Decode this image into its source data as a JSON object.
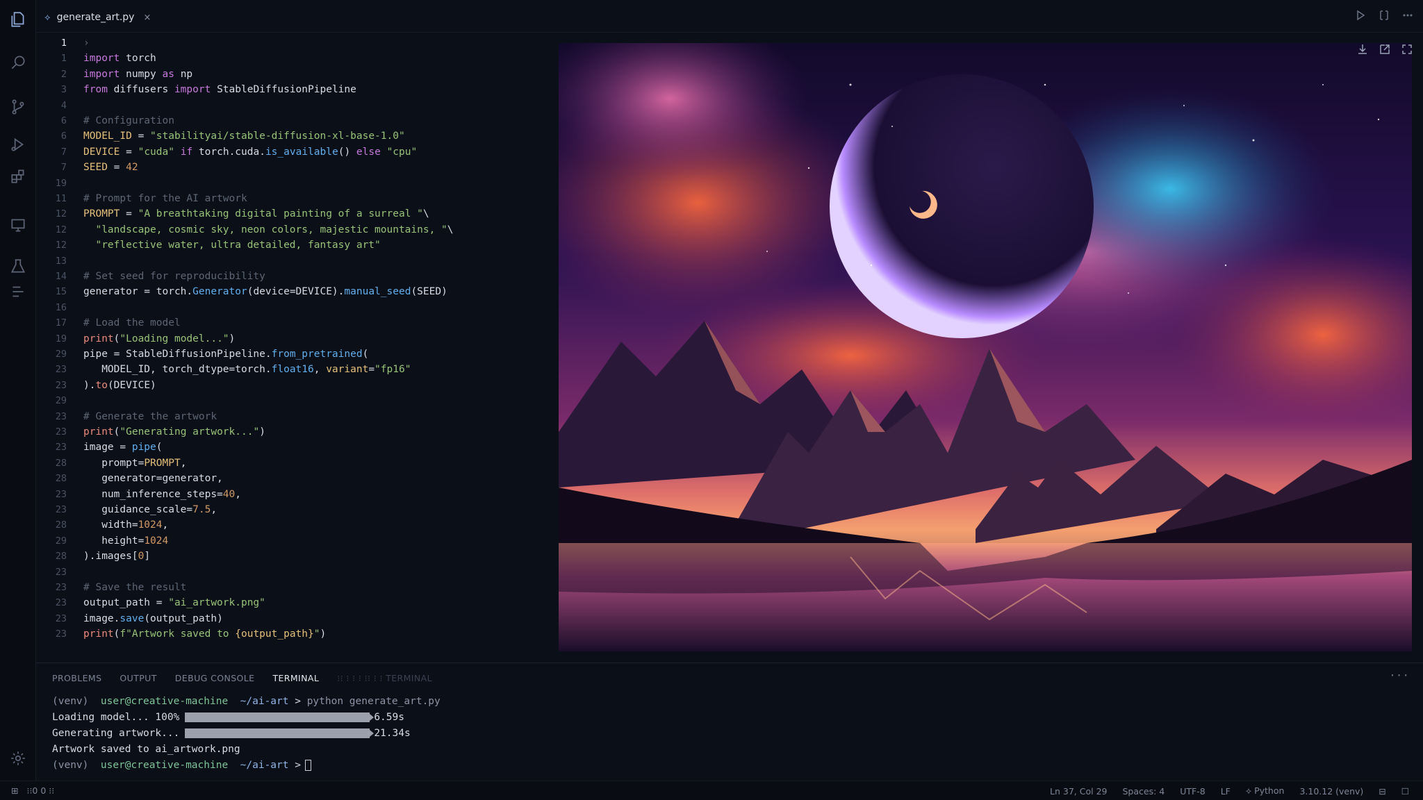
{
  "tab": {
    "filename": "generate_art.py",
    "close_glyph": "×"
  },
  "editor": {
    "lines": [
      {
        "n": "1",
        "current": true,
        "parts": [
          [
            "cm",
            "›"
          ]
        ]
      },
      {
        "n": "1",
        "parts": [
          [
            "kw",
            "import"
          ],
          [
            "id",
            " torch"
          ]
        ]
      },
      {
        "n": "2",
        "parts": [
          [
            "kw",
            "import"
          ],
          [
            "id",
            " numpy "
          ],
          [
            "kw",
            "as"
          ],
          [
            "id",
            " np"
          ]
        ]
      },
      {
        "n": "3",
        "parts": [
          [
            "kw",
            "from"
          ],
          [
            "id",
            " diffusers "
          ],
          [
            "kw",
            "import"
          ],
          [
            "id",
            " StableDiffusionPipeline"
          ]
        ]
      },
      {
        "n": "4",
        "parts": []
      },
      {
        "n": "6",
        "parts": [
          [
            "cm",
            "# Configuration"
          ]
        ]
      },
      {
        "n": "6",
        "parts": [
          [
            "attr",
            "MODEL_ID"
          ],
          [
            "id",
            " = "
          ],
          [
            "str",
            "\"stabilityai/stable-diffusion-xl-base-1.0\""
          ]
        ]
      },
      {
        "n": "7",
        "parts": [
          [
            "attr",
            "DEVICE"
          ],
          [
            "id",
            " = "
          ],
          [
            "str",
            "\"cuda\""
          ],
          [
            "id",
            " "
          ],
          [
            "kw",
            "if"
          ],
          [
            "id",
            " torch.cuda."
          ],
          [
            "fn",
            "is_available"
          ],
          [
            "id",
            "() "
          ],
          [
            "kw",
            "else"
          ],
          [
            "id",
            " "
          ],
          [
            "str",
            "\"cpu\""
          ]
        ]
      },
      {
        "n": "7",
        "parts": [
          [
            "attr",
            "SEED"
          ],
          [
            "id",
            " = "
          ],
          [
            "num",
            "42"
          ]
        ]
      },
      {
        "n": "19",
        "parts": []
      },
      {
        "n": "11",
        "parts": [
          [
            "cm",
            "# Prompt for the AI artwork"
          ]
        ]
      },
      {
        "n": "12",
        "parts": [
          [
            "attr",
            "PROMPT"
          ],
          [
            "id",
            " = "
          ],
          [
            "str",
            "\"A breathtaking digital painting of a surreal \""
          ],
          [
            "id",
            "\\"
          ]
        ]
      },
      {
        "n": "12",
        "parts": [
          [
            "str",
            "  \"landscape, cosmic sky, neon colors, majestic mountains, \""
          ],
          [
            "id",
            "\\"
          ]
        ]
      },
      {
        "n": "12",
        "parts": [
          [
            "str",
            "  \"reflective water, ultra detailed, fantasy art\""
          ]
        ]
      },
      {
        "n": "13",
        "parts": []
      },
      {
        "n": "14",
        "parts": [
          [
            "cm",
            "# Set seed for reproducibility"
          ]
        ]
      },
      {
        "n": "15",
        "parts": [
          [
            "id",
            "generator = torch."
          ],
          [
            "fn",
            "Generator"
          ],
          [
            "id",
            "(device=DEVICE)."
          ],
          [
            "fn",
            "manual_seed"
          ],
          [
            "id",
            "(SEED)"
          ]
        ]
      },
      {
        "n": "16",
        "parts": []
      },
      {
        "n": "17",
        "parts": [
          [
            "cm",
            "# Load the model"
          ]
        ]
      },
      {
        "n": "19",
        "parts": [
          [
            "red",
            "print"
          ],
          [
            "id",
            "("
          ],
          [
            "str",
            "\"Loading model...\""
          ],
          [
            "id",
            ")"
          ]
        ]
      },
      {
        "n": "29",
        "parts": [
          [
            "id",
            "pipe = StableDiffusionPipeline."
          ],
          [
            "fn",
            "from_pretrained"
          ],
          [
            "id",
            "("
          ]
        ]
      },
      {
        "n": "23",
        "parts": [
          [
            "id",
            "   MODEL_ID, torch_dtype=torch."
          ],
          [
            "fn",
            "float16"
          ],
          [
            "id",
            ", "
          ],
          [
            "attr",
            "variant"
          ],
          [
            "id",
            "="
          ],
          [
            "str",
            "\"fp16\""
          ]
        ]
      },
      {
        "n": "23",
        "parts": [
          [
            "id",
            ")."
          ],
          [
            "red",
            "to"
          ],
          [
            "id",
            "(DEVICE)"
          ]
        ]
      },
      {
        "n": "29",
        "parts": []
      },
      {
        "n": "23",
        "parts": [
          [
            "cm",
            "# Generate the artwork"
          ]
        ]
      },
      {
        "n": "23",
        "parts": [
          [
            "red",
            "print"
          ],
          [
            "id",
            "("
          ],
          [
            "str",
            "\"Generating artwork...\""
          ],
          [
            "id",
            ")"
          ]
        ]
      },
      {
        "n": "23",
        "parts": [
          [
            "id",
            "image = "
          ],
          [
            "fn",
            "pipe"
          ],
          [
            "id",
            "("
          ]
        ]
      },
      {
        "n": "28",
        "parts": [
          [
            "id",
            "   prompt="
          ],
          [
            "attr",
            "PROMPT"
          ],
          [
            "id",
            ","
          ]
        ]
      },
      {
        "n": "28",
        "parts": [
          [
            "id",
            "   generator=generator,"
          ]
        ]
      },
      {
        "n": "23",
        "parts": [
          [
            "id",
            "   num_inference_steps="
          ],
          [
            "num",
            "40"
          ],
          [
            "id",
            ","
          ]
        ]
      },
      {
        "n": "23",
        "parts": [
          [
            "id",
            "   guidance_scale="
          ],
          [
            "num",
            "7.5"
          ],
          [
            "id",
            ","
          ]
        ]
      },
      {
        "n": "28",
        "parts": [
          [
            "id",
            "   width="
          ],
          [
            "num",
            "1024"
          ],
          [
            "id",
            ","
          ]
        ]
      },
      {
        "n": "29",
        "parts": [
          [
            "id",
            "   height="
          ],
          [
            "num",
            "1024"
          ]
        ]
      },
      {
        "n": "28",
        "parts": [
          [
            "id",
            ").images["
          ],
          [
            "num",
            "0"
          ],
          [
            "id",
            "]"
          ]
        ]
      },
      {
        "n": "23",
        "parts": []
      },
      {
        "n": "23",
        "parts": [
          [
            "cm",
            "# Save the result"
          ]
        ]
      },
      {
        "n": "23",
        "parts": [
          [
            "id",
            "output_path = "
          ],
          [
            "str",
            "\"ai_artwork.png\""
          ]
        ]
      },
      {
        "n": "23",
        "parts": [
          [
            "id",
            "image."
          ],
          [
            "fn",
            "save"
          ],
          [
            "id",
            "(output_path)"
          ]
        ]
      },
      {
        "n": "23",
        "parts": [
          [
            "red",
            "print"
          ],
          [
            "id",
            "("
          ],
          [
            "str",
            "f\"Artwork saved to "
          ],
          [
            "attr",
            "{output_path}"
          ],
          [
            "str",
            "\""
          ],
          [
            "id",
            ")"
          ]
        ]
      }
    ]
  },
  "panel": {
    "tabs": [
      "PROBLEMS",
      "OUTPUT",
      "DEBUG CONSOLE",
      "TERMINAL"
    ],
    "ghost_tab": "⁝⁝ ⁝ ⁝ ⁝ ⁝⁝ ⁝ ⁝ TERMINAL",
    "more_glyph": "···",
    "terminal": {
      "venv": "(venv)",
      "user": "user@creative-machine",
      "path": "~/ai-art",
      "prompt_glyph": ">",
      "command": "python generate_art.py",
      "loading_label": "Loading model... 100%",
      "loading_time": "6.59s",
      "loading_progress": 1.0,
      "generating_label": "Generating artwork...",
      "generating_time": "21.34s",
      "generating_progress": 1.0,
      "saved": "Artwork saved to ai_artwork.png"
    }
  },
  "status": {
    "left": "⁝⁝0 0 ⁝⁝",
    "position": "Ln 37, Col 29",
    "spaces": "Spaces: 4",
    "encoding": "UTF-8",
    "eol": "LF",
    "language": "Python",
    "interpreter": "3.10.12 (venv)"
  },
  "colors": {
    "accent": "#8fb4e8",
    "string": "#98c379",
    "keyword": "#c678dd",
    "function": "#61afef"
  }
}
